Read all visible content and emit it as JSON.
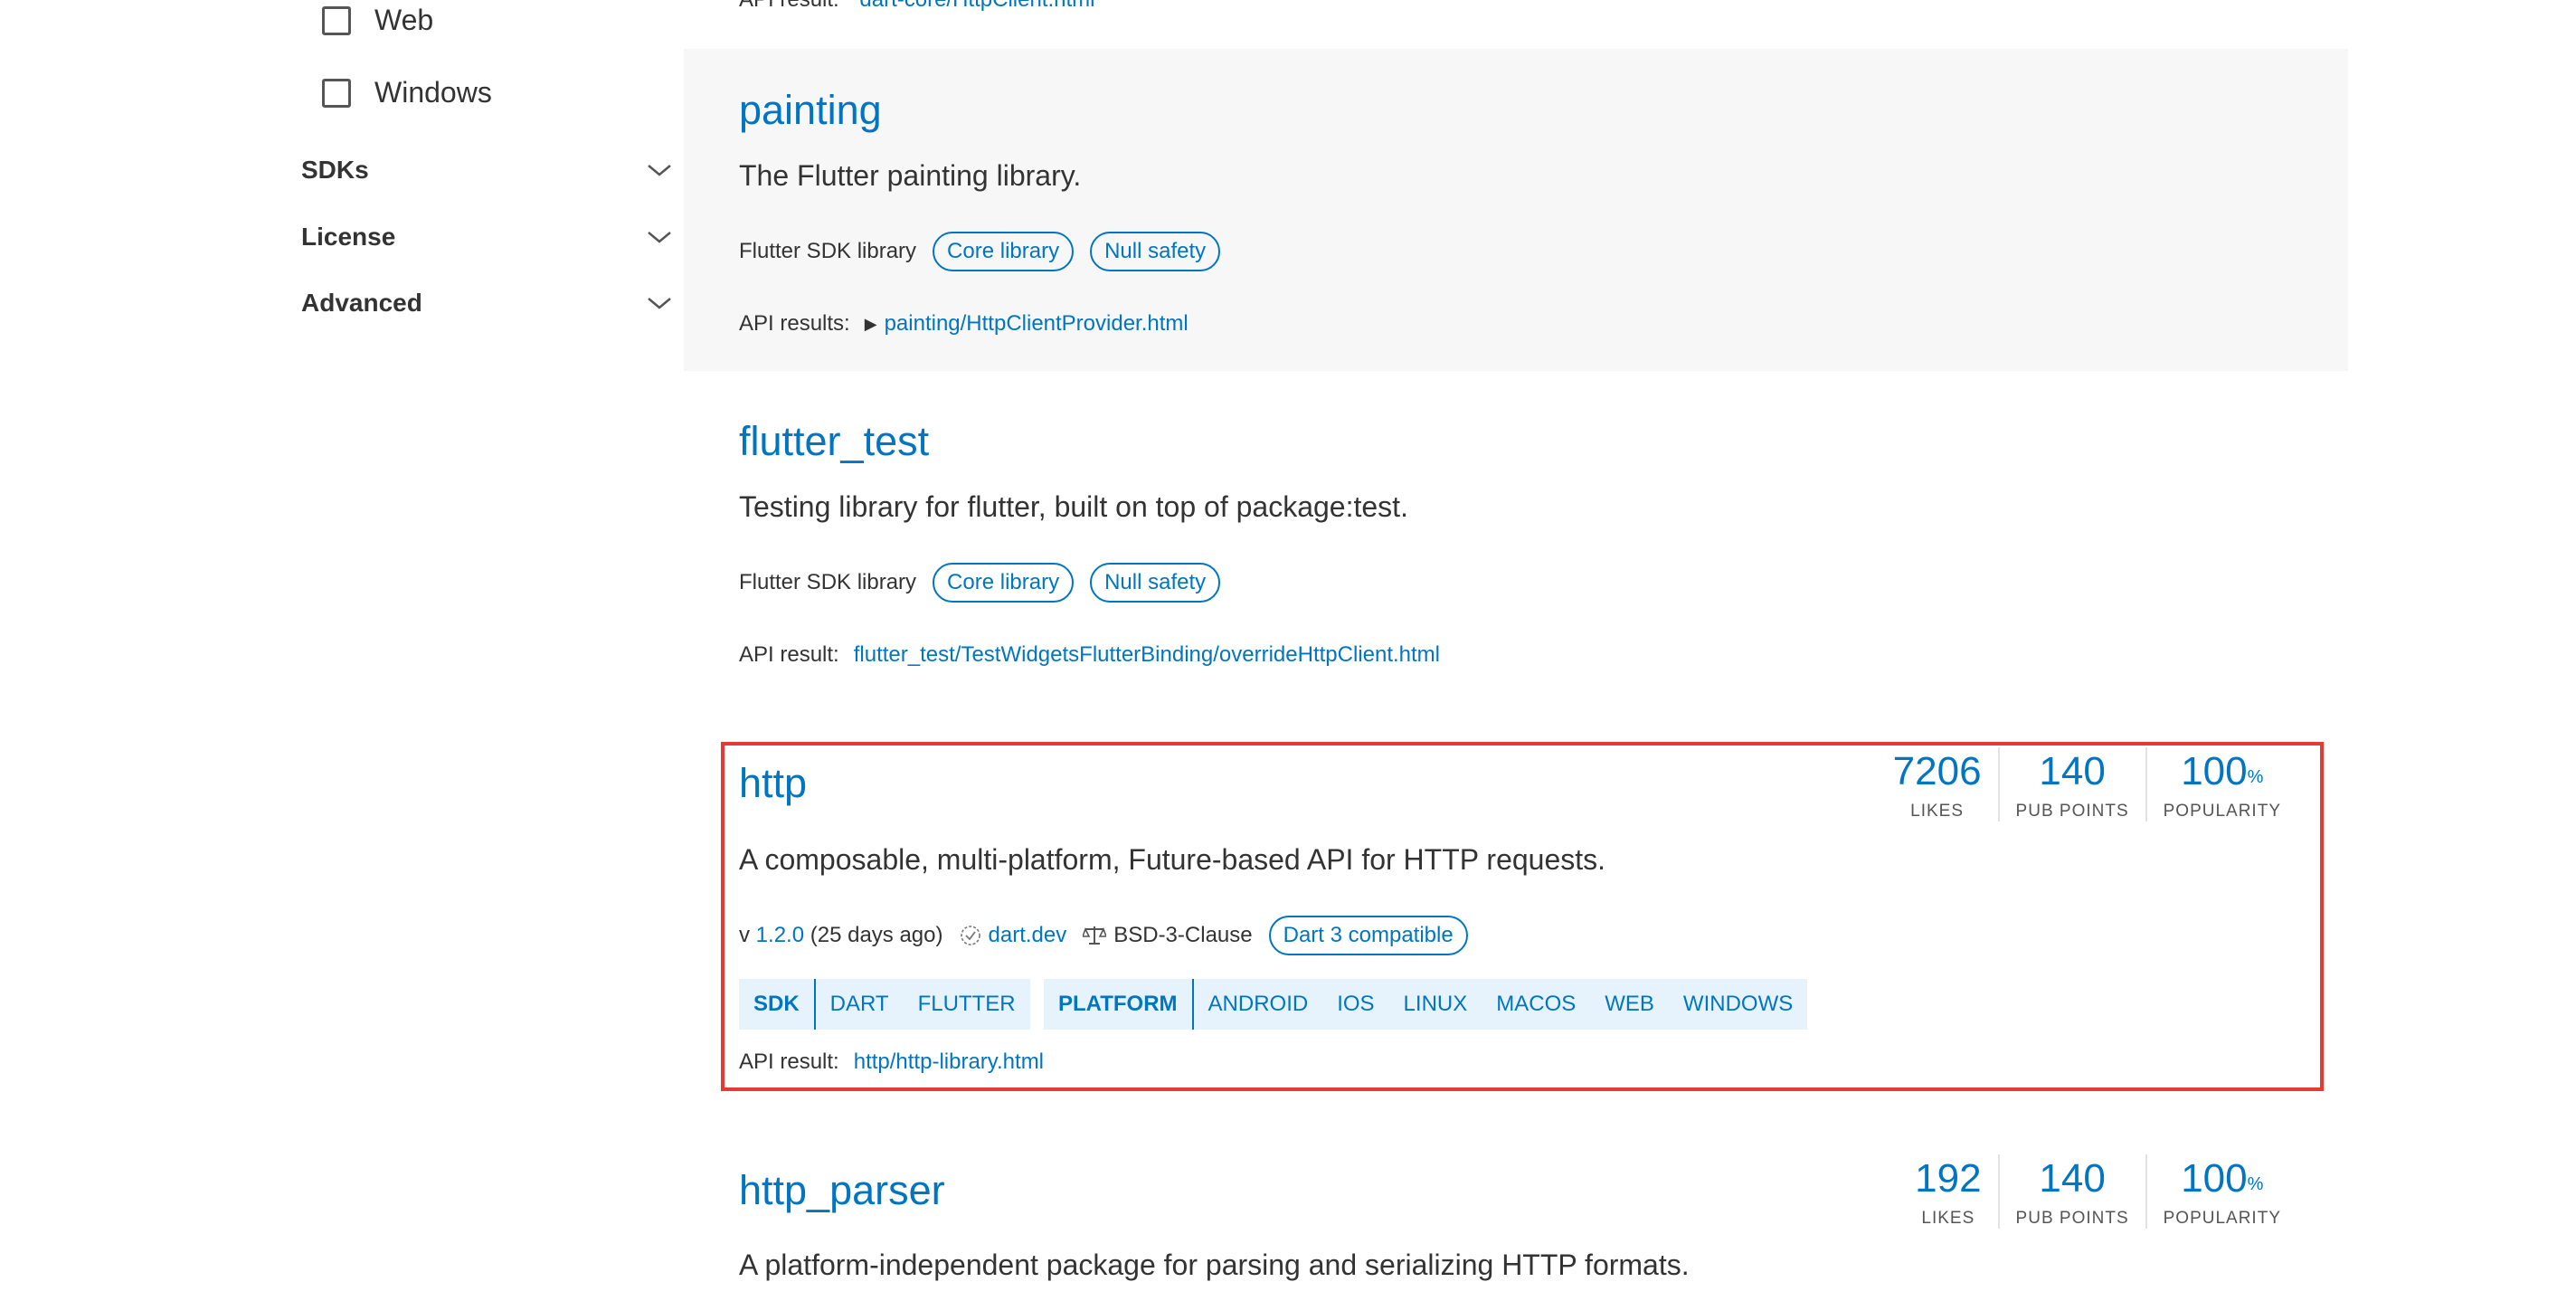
{
  "sidebar": {
    "checkboxes": [
      {
        "label": "Web"
      },
      {
        "label": "Windows"
      }
    ],
    "sections": [
      {
        "title": "SDKs"
      },
      {
        "title": "License"
      },
      {
        "title": "Advanced"
      }
    ]
  },
  "top_cut": {
    "label": "API result:",
    "link": "dart-core/HttpClient.html"
  },
  "results": [
    {
      "name": "painting",
      "description": "The Flutter painting library.",
      "source": "Flutter SDK library",
      "chips": [
        "Core library",
        "Null safety"
      ],
      "api_label": "API results:",
      "api_toggle": "▶",
      "api_link": "painting/HttpClientProvider.html"
    },
    {
      "name": "flutter_test",
      "description": "Testing library for flutter, built on top of package:test.",
      "source": "Flutter SDK library",
      "chips": [
        "Core library",
        "Null safety"
      ],
      "api_label": "API result:",
      "api_link": "flutter_test/TestWidgetsFlutterBinding/overrideHttpClient.html"
    },
    {
      "name": "http",
      "description": "A composable, multi-platform, Future-based API for HTTP requests.",
      "version_prefix": "v",
      "version": "1.2.0",
      "age": "(25 days ago)",
      "publisher": "dart.dev",
      "license": "BSD-3-Clause",
      "compat_chip": "Dart 3 compatible",
      "stats": [
        {
          "value": "7206",
          "suffix": "",
          "label": "LIKES"
        },
        {
          "value": "140",
          "suffix": "",
          "label": "PUB POINTS"
        },
        {
          "value": "100",
          "suffix": "%",
          "label": "POPULARITY"
        }
      ],
      "sdk_tags": {
        "head": "SDK",
        "items": [
          "DART",
          "FLUTTER"
        ]
      },
      "platform_tags": {
        "head": "PLATFORM",
        "items": [
          "ANDROID",
          "IOS",
          "LINUX",
          "MACOS",
          "WEB",
          "WINDOWS"
        ]
      },
      "api_label": "API result:",
      "api_link": "http/http-library.html"
    },
    {
      "name": "http_parser",
      "description": "A platform-independent package for parsing and serializing HTTP formats.",
      "stats": [
        {
          "value": "192",
          "suffix": "",
          "label": "LIKES"
        },
        {
          "value": "140",
          "suffix": "",
          "label": "PUB POINTS"
        },
        {
          "value": "100",
          "suffix": "%",
          "label": "POPULARITY"
        }
      ]
    }
  ],
  "colors": {
    "accent": "#0175c2",
    "highlight": "#e53935",
    "tag_bg": "#e6f3fc",
    "card_shade": "#f7f7f7"
  }
}
